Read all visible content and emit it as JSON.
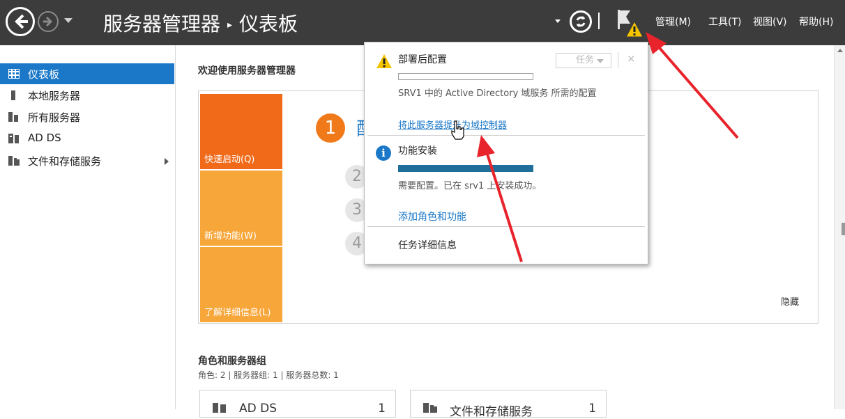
{
  "topbar": {
    "title": "服务器管理器",
    "separator": "▸",
    "page": "仪表板",
    "menus": [
      "管理(M)",
      "工具(T)",
      "视图(V)",
      "帮助(H)"
    ]
  },
  "sidebar": {
    "items": [
      {
        "label": "仪表板",
        "icon": "dashboard-icon",
        "active": true
      },
      {
        "label": "本地服务器",
        "icon": "server-icon"
      },
      {
        "label": "所有服务器",
        "icon": "servers-icon"
      },
      {
        "label": "AD DS",
        "icon": "ad-ds-icon"
      },
      {
        "label": "文件和存储服务",
        "icon": "file-storage-icon",
        "expandable": true
      }
    ]
  },
  "main": {
    "welcome": "欢迎使用服务器管理器",
    "tiles": [
      {
        "label": "快速启动(Q)",
        "color": "#f06a1a"
      },
      {
        "label": "新增功能(W)",
        "color": "#f7a63a"
      },
      {
        "label": "了解详细信息(L)",
        "color": "#f7a63a"
      }
    ],
    "steps": [
      "1",
      "2",
      "3",
      "4"
    ],
    "step1_text": "配",
    "hide": "隐藏",
    "roles_title": "角色和服务器组",
    "roles_summary": "角色: 2 | 服务器组: 1 | 服务器总数: 1",
    "cards": [
      {
        "name": "AD DS",
        "count": "1"
      },
      {
        "name": "文件和存储服务",
        "count": "1"
      }
    ]
  },
  "popup": {
    "section1": {
      "title": "部署后配置",
      "task_button": "任务",
      "close": "×",
      "message": "SRV1 中的 Active Directory 域服务 所需的配置",
      "link": "将此服务器提升为域控制器",
      "progress": 0
    },
    "section2": {
      "title": "功能安装",
      "message": "需要配置。已在 srv1 上安装成功。",
      "link": "添加角色和功能",
      "progress": 1.0
    },
    "task_details": "任务详细信息"
  },
  "colors": {
    "topbar": "#3c3c3c",
    "accent": "#1b78c8",
    "warning": "#f5c400",
    "arrow": "#e8232b"
  }
}
